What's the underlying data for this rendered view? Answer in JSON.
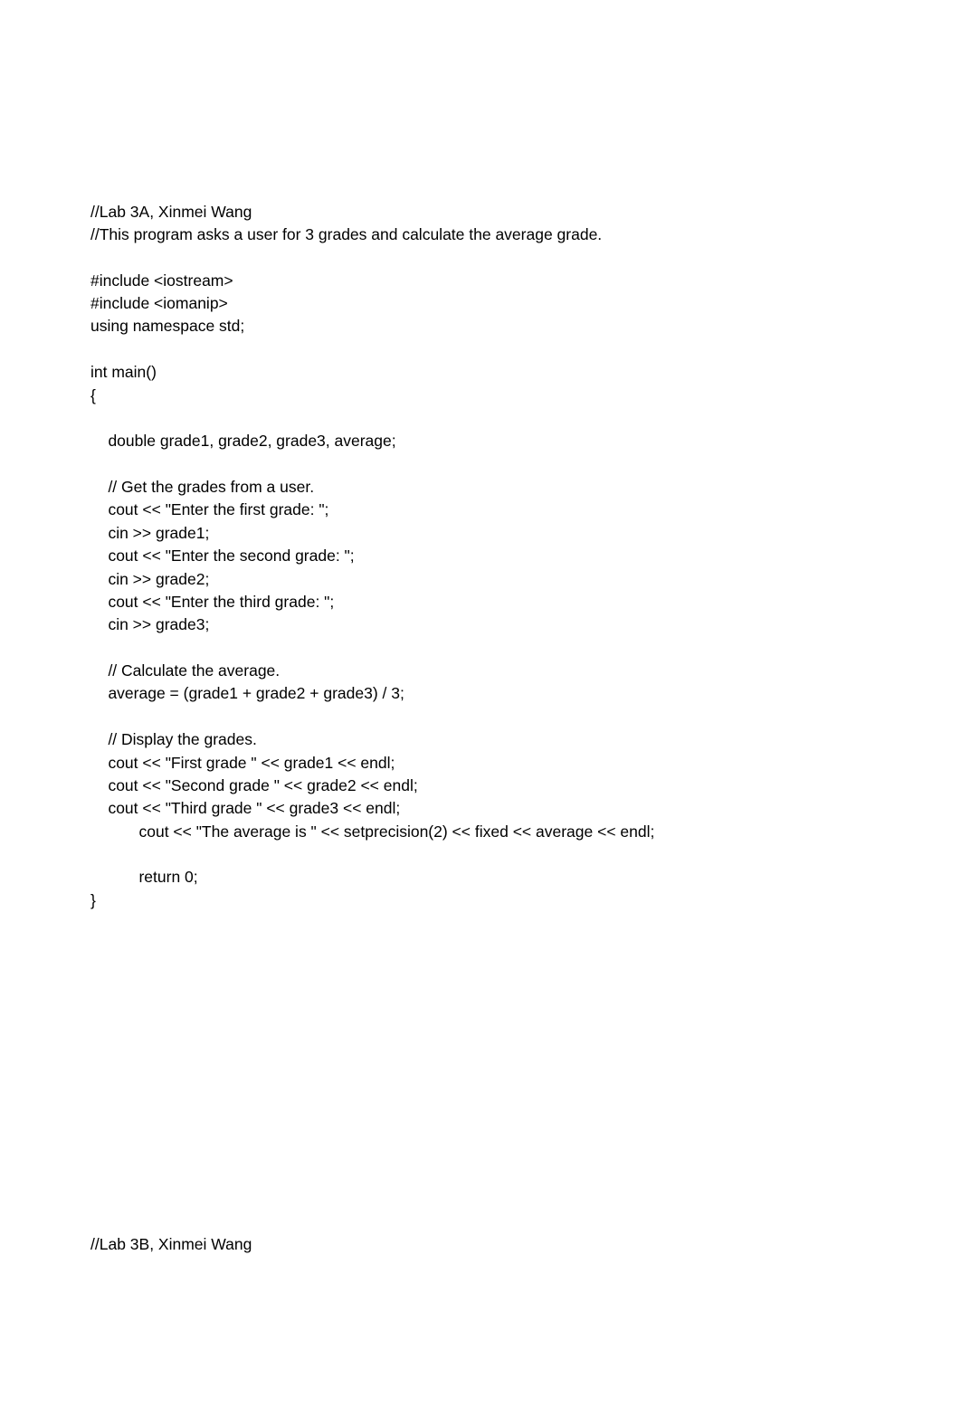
{
  "lines": [
    "//Lab 3A, Xinmei Wang",
    "//This program asks a user for 3 grades and calculate the average grade.",
    "",
    "#include <iostream>",
    "#include <iomanip>",
    "using namespace std;",
    "",
    "int main()",
    "{",
    "",
    "    double grade1, grade2, grade3, average;",
    "",
    "    // Get the grades from a user.",
    "    cout << \"Enter the first grade: \";",
    "    cin >> grade1;",
    "    cout << \"Enter the second grade: \";",
    "    cin >> grade2;",
    "    cout << \"Enter the third grade: \";",
    "    cin >> grade3;",
    "",
    "    // Calculate the average.",
    "    average = (grade1 + grade2 + grade3) / 3;",
    "",
    "    // Display the grades.",
    "    cout << \"First grade \" << grade1 << endl;",
    "    cout << \"Second grade \" << grade2 << endl;",
    "    cout << \"Third grade \" << grade3 << endl;",
    "           cout << \"The average is \" << setprecision(2) << fixed << average << endl;",
    "",
    "           return 0;",
    "}",
    "",
    "",
    "",
    "",
    "",
    "",
    "",
    "",
    "",
    "",
    "",
    "",
    "",
    "",
    "//Lab 3B, Xinmei Wang"
  ]
}
